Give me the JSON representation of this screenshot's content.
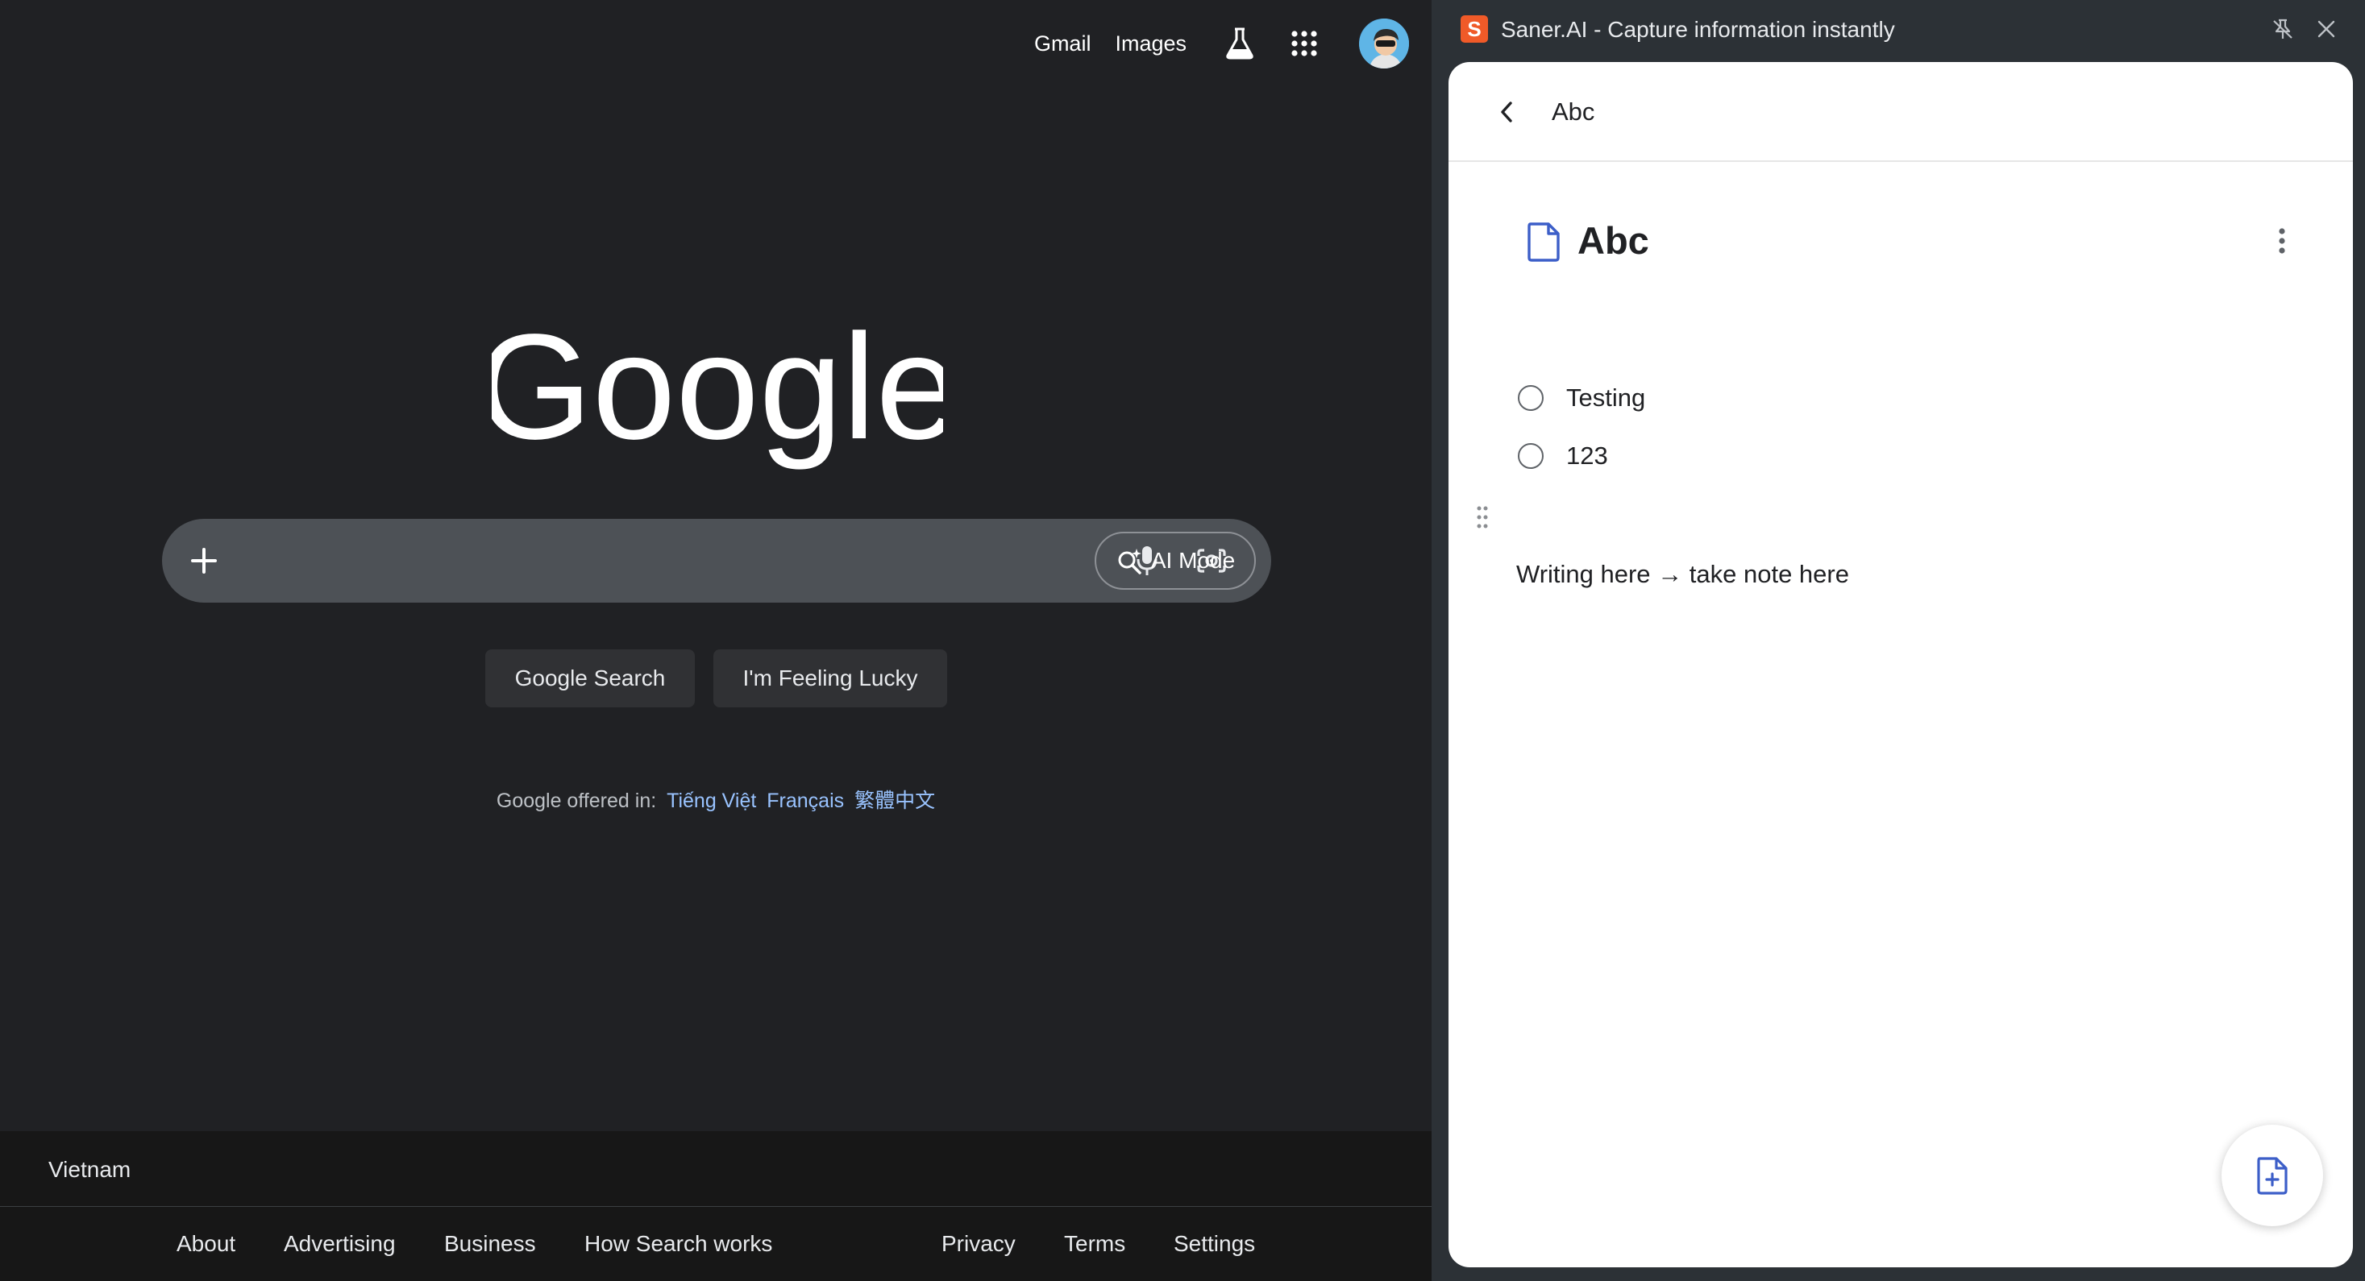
{
  "google": {
    "top_links": {
      "gmail": "Gmail",
      "images": "Images"
    },
    "icons": {
      "labs": "labs-flask-icon",
      "apps": "apps-grid-icon",
      "avatar": "user-avatar"
    },
    "logo_text": "Google",
    "search": {
      "value": "",
      "placeholder": "",
      "ai_mode_label": "AI Mode"
    },
    "buttons": {
      "search": "Google Search",
      "lucky": "I'm Feeling Lucky"
    },
    "offered": {
      "prefix": "Google offered in:",
      "languages": [
        "Tiếng Việt",
        "Français",
        "繁體中文"
      ]
    },
    "footer": {
      "country": "Vietnam",
      "left_links": [
        "About",
        "Advertising",
        "Business",
        "How Search works"
      ],
      "right_links": [
        "Privacy",
        "Terms",
        "Settings"
      ]
    },
    "colors": {
      "background": "#202124",
      "link": "#99c3ff",
      "searchbox": "#4d5156"
    }
  },
  "saner": {
    "logo_letter": "S",
    "window_title": "Saner.AI - Capture information instantly",
    "header_title": "Abc",
    "doc_title": "Abc",
    "todos": [
      "Testing",
      "123"
    ],
    "note": "Writing here → take note here",
    "colors": {
      "brand": "#f05a28",
      "accent": "#3c5ec8"
    }
  }
}
